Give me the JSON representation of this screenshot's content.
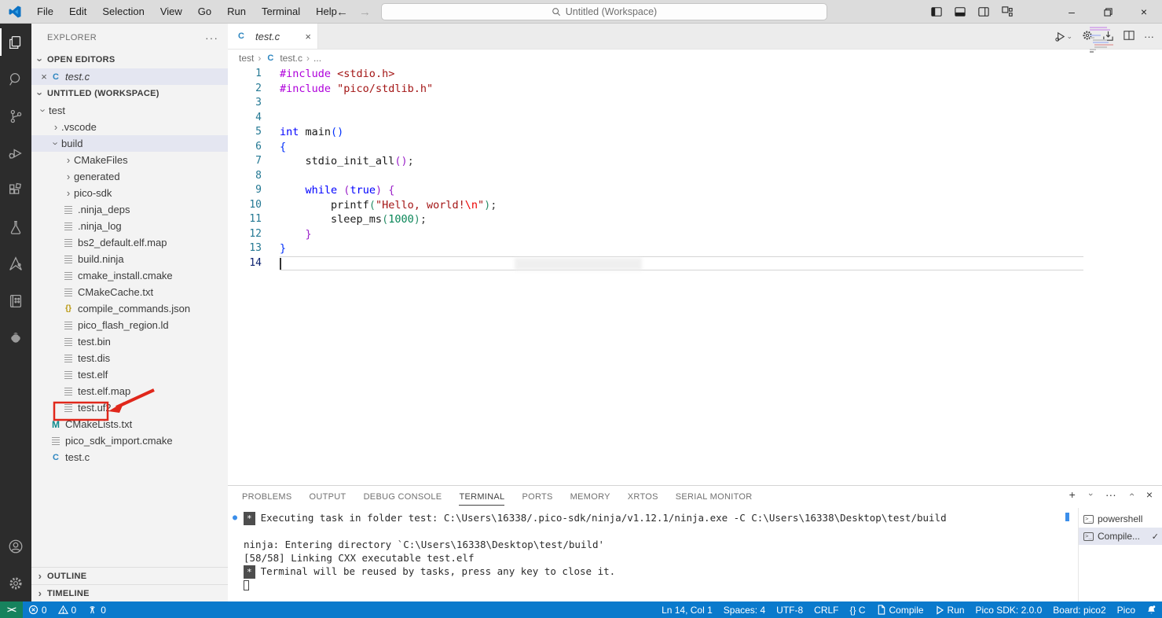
{
  "colors": {
    "statusbar": "#0a7acc",
    "remote": "#16825d",
    "annotation": "#e0271b",
    "activitybar": "#2c2c2c",
    "titlebar": "#dcdcdc",
    "sidebar": "#f3f3f3",
    "selection": "#e4e6f1"
  },
  "title_bar": {
    "menus": [
      "File",
      "Edit",
      "Selection",
      "View",
      "Go",
      "Run",
      "Terminal",
      "Help"
    ],
    "search_label": "Untitled (Workspace)",
    "back_arrow": "←",
    "forward_arrow": "→",
    "minimize": "–",
    "close": "×"
  },
  "sidebar": {
    "title": "EXPLORER",
    "more_actions": "···",
    "sections": {
      "open_editors": "OPEN EDITORS",
      "workspace": "UNTITLED (WORKSPACE)",
      "outline": "OUTLINE",
      "timeline": "TIMELINE"
    },
    "open_editor_items": [
      {
        "label": "test.c",
        "icon": "c",
        "selected": true
      }
    ],
    "tree": [
      {
        "label": "test",
        "depth": 0,
        "kind": "folder",
        "expanded": true
      },
      {
        "label": ".vscode",
        "depth": 1,
        "kind": "folder",
        "expanded": false
      },
      {
        "label": "build",
        "depth": 1,
        "kind": "folder",
        "expanded": true,
        "selected": true
      },
      {
        "label": "CMakeFiles",
        "depth": 2,
        "kind": "folder",
        "expanded": false
      },
      {
        "label": "generated",
        "depth": 2,
        "kind": "folder",
        "expanded": false
      },
      {
        "label": "pico-sdk",
        "depth": 2,
        "kind": "folder",
        "expanded": false
      },
      {
        "label": ".ninja_deps",
        "depth": 2,
        "kind": "file",
        "icon": "file"
      },
      {
        "label": ".ninja_log",
        "depth": 2,
        "kind": "file",
        "icon": "file"
      },
      {
        "label": "bs2_default.elf.map",
        "depth": 2,
        "kind": "file",
        "icon": "file"
      },
      {
        "label": "build.ninja",
        "depth": 2,
        "kind": "file",
        "icon": "file"
      },
      {
        "label": "cmake_install.cmake",
        "depth": 2,
        "kind": "file",
        "icon": "file"
      },
      {
        "label": "CMakeCache.txt",
        "depth": 2,
        "kind": "file",
        "icon": "file"
      },
      {
        "label": "compile_commands.json",
        "depth": 2,
        "kind": "file",
        "icon": "json"
      },
      {
        "label": "pico_flash_region.ld",
        "depth": 2,
        "kind": "file",
        "icon": "file"
      },
      {
        "label": "test.bin",
        "depth": 2,
        "kind": "file",
        "icon": "file"
      },
      {
        "label": "test.dis",
        "depth": 2,
        "kind": "file",
        "icon": "file"
      },
      {
        "label": "test.elf",
        "depth": 2,
        "kind": "file",
        "icon": "file"
      },
      {
        "label": "test.elf.map",
        "depth": 2,
        "kind": "file",
        "icon": "file"
      },
      {
        "label": "test.uf2",
        "depth": 2,
        "kind": "file",
        "icon": "file",
        "boxed": true
      },
      {
        "label": "CMakeLists.txt",
        "depth": 1,
        "kind": "file",
        "icon": "m"
      },
      {
        "label": "pico_sdk_import.cmake",
        "depth": 1,
        "kind": "file",
        "icon": "file"
      },
      {
        "label": "test.c",
        "depth": 1,
        "kind": "file",
        "icon": "c"
      }
    ]
  },
  "editor": {
    "tab": {
      "label": "test.c",
      "close": "×"
    },
    "breadcrumb": {
      "items": [
        "test",
        "test.c",
        "..."
      ]
    },
    "code": {
      "current_line": 14,
      "lines": [
        {
          "n": 1,
          "toks": [
            [
              "dir",
              "#include"
            ],
            [
              "pln",
              " "
            ],
            [
              "str",
              "<stdio.h>"
            ]
          ]
        },
        {
          "n": 2,
          "toks": [
            [
              "dir",
              "#include"
            ],
            [
              "pln",
              " "
            ],
            [
              "str",
              "\"pico/stdlib.h\""
            ]
          ]
        },
        {
          "n": 3,
          "toks": []
        },
        {
          "n": 4,
          "toks": []
        },
        {
          "n": 5,
          "toks": [
            [
              "kw",
              "int"
            ],
            [
              "pln",
              " "
            ],
            [
              "fn",
              "main"
            ],
            [
              "b1",
              "()"
            ]
          ]
        },
        {
          "n": 6,
          "toks": [
            [
              "b1",
              "{"
            ]
          ]
        },
        {
          "n": 7,
          "toks": [
            [
              "pln",
              "    "
            ],
            [
              "fn",
              "stdio_init_all"
            ],
            [
              "b2",
              "()"
            ],
            [
              "pln",
              ";"
            ]
          ]
        },
        {
          "n": 8,
          "toks": []
        },
        {
          "n": 9,
          "toks": [
            [
              "pln",
              "    "
            ],
            [
              "kw",
              "while"
            ],
            [
              "pln",
              " "
            ],
            [
              "b2",
              "("
            ],
            [
              "kw",
              "true"
            ],
            [
              "b2",
              ")"
            ],
            [
              "pln",
              " "
            ],
            [
              "b2",
              "{"
            ]
          ]
        },
        {
          "n": 10,
          "toks": [
            [
              "pln",
              "        "
            ],
            [
              "fn",
              "printf"
            ],
            [
              "b3",
              "("
            ],
            [
              "str",
              "\"Hello, world!"
            ],
            [
              "esc",
              "\\n"
            ],
            [
              "str",
              "\""
            ],
            [
              "b3",
              ")"
            ],
            [
              "pln",
              ";"
            ]
          ]
        },
        {
          "n": 11,
          "toks": [
            [
              "pln",
              "        "
            ],
            [
              "fn",
              "sleep_ms"
            ],
            [
              "b3",
              "("
            ],
            [
              "num",
              "1000"
            ],
            [
              "b3",
              ")"
            ],
            [
              "pln",
              ";"
            ]
          ]
        },
        {
          "n": 12,
          "toks": [
            [
              "pln",
              "    "
            ],
            [
              "b2",
              "}"
            ]
          ]
        },
        {
          "n": 13,
          "toks": [
            [
              "b1",
              "}"
            ]
          ]
        },
        {
          "n": 14,
          "toks": []
        }
      ]
    }
  },
  "panel": {
    "tabs": [
      {
        "label": "PROBLEMS"
      },
      {
        "label": "OUTPUT"
      },
      {
        "label": "DEBUG CONSOLE"
      },
      {
        "label": "TERMINAL",
        "active": true
      },
      {
        "label": "PORTS"
      },
      {
        "label": "MEMORY"
      },
      {
        "label": "XRTOS"
      },
      {
        "label": "SERIAL MONITOR"
      }
    ],
    "actions": {
      "new": "+",
      "dropdown": "›",
      "more": "···",
      "maximize": "›",
      "close": "×"
    },
    "terminal": {
      "lines": [
        {
          "dot": true,
          "badge": "*",
          "text": "Executing task in folder test: C:\\Users\\16338/.pico-sdk/ninja/v1.12.1/ninja.exe -C C:\\Users\\16338\\Desktop\\test/build"
        },
        {
          "text": ""
        },
        {
          "text": "ninja: Entering directory `C:\\Users\\16338\\Desktop\\test/build'"
        },
        {
          "text": "[58/58] Linking CXX executable test.elf"
        },
        {
          "badge": "*",
          "text": "Terminal will be reused by tasks, press any key to close it."
        },
        {
          "cursor": true,
          "text": ""
        }
      ]
    },
    "terminal_list": [
      {
        "label": "powershell",
        "selected": false,
        "check": false
      },
      {
        "label": "Compile...",
        "selected": true,
        "check": true
      }
    ]
  },
  "status_bar": {
    "remote_glyph": "><",
    "left": [
      {
        "icon": "errors",
        "text": "0"
      },
      {
        "icon": "warnings",
        "text": "0"
      },
      {
        "icon": "tower",
        "text": "0"
      }
    ],
    "right": [
      {
        "text": "Ln 14, Col 1"
      },
      {
        "text": "Spaces: 4"
      },
      {
        "text": "UTF-8"
      },
      {
        "text": "CRLF"
      },
      {
        "text": "{} C"
      },
      {
        "icon": "file",
        "text": "Compile"
      },
      {
        "icon": "run",
        "text": "Run"
      },
      {
        "text": "Pico SDK: 2.0.0"
      },
      {
        "text": "Board: pico2"
      },
      {
        "text": "Pico"
      },
      {
        "icon": "bell",
        "text": ""
      }
    ]
  }
}
